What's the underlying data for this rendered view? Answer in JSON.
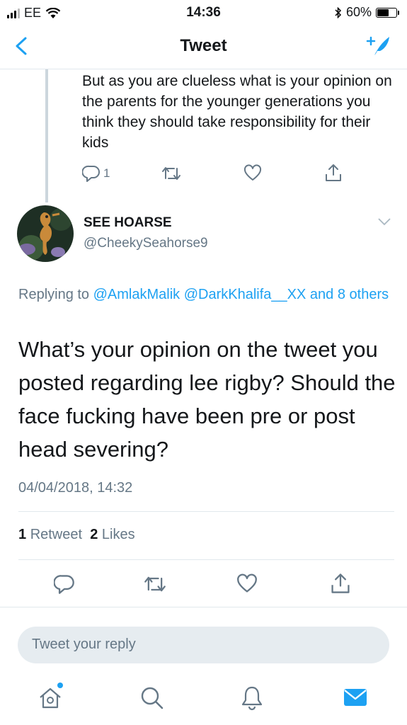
{
  "status_bar": {
    "carrier": "EE",
    "time": "14:36",
    "battery": "60%",
    "battery_level": 0.6
  },
  "nav": {
    "title": "Tweet"
  },
  "parent_tweet": {
    "text": "But as you are clueless what is your opinion on the parents for the younger generations you think they should take responsibility for their kids",
    "reply_count": "1"
  },
  "tweet": {
    "display_name": "SEE HOARSE",
    "handle": "@CheekySeahorse9",
    "replying_prefix": "Replying to",
    "replying_mentions": [
      "@AmlakMalik",
      "@DarkKhalifa__XX",
      "and",
      "8 others"
    ],
    "text": "What’s your opinion on the tweet you posted regarding lee rigby? Should the face fucking have been pre or post head severing?",
    "timestamp": "04/04/2018, 14:32",
    "retweet_count": "1",
    "retweet_label": "Retweet",
    "like_count": "2",
    "like_label": "Likes"
  },
  "reply_box": {
    "placeholder": "Tweet your reply"
  },
  "colors": {
    "accent": "#1da1f2",
    "muted": "#657786",
    "divider": "#e1e8ed"
  },
  "icons": {
    "nav": [
      "back-chevron-icon",
      "compose-tweet-icon"
    ],
    "actions": [
      "reply-icon",
      "retweet-icon",
      "like-icon",
      "share-icon"
    ],
    "tabs": [
      "home-icon",
      "search-icon",
      "notifications-icon",
      "messages-icon"
    ]
  }
}
